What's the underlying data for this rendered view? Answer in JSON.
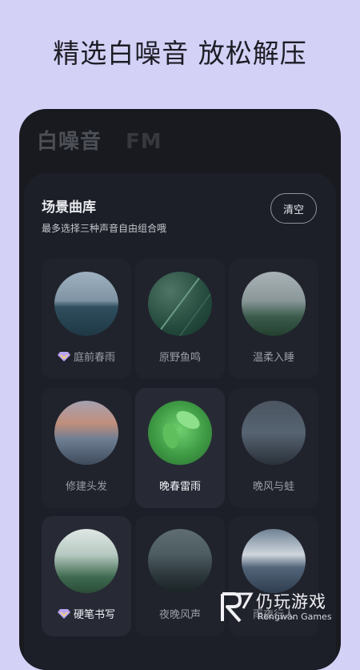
{
  "headline": "精选白噪音  放松解压",
  "tabs": [
    {
      "label": "白噪音",
      "active": true
    },
    {
      "label": "FM",
      "active": false
    }
  ],
  "library": {
    "title": "场景曲库",
    "subtitle": "最多选择三种声音自由组合哦",
    "clear_label": "清空"
  },
  "sounds": [
    {
      "label": "庭前春雨",
      "vip": true,
      "selected": false
    },
    {
      "label": "原野鱼鸣",
      "vip": false,
      "selected": false
    },
    {
      "label": "温柔入睡",
      "vip": false,
      "selected": false
    },
    {
      "label": "修建头发",
      "vip": false,
      "selected": false
    },
    {
      "label": "晚春雷雨",
      "vip": false,
      "selected": true
    },
    {
      "label": "晚风与蛙",
      "vip": false,
      "selected": false
    },
    {
      "label": "硬笔书写",
      "vip": true,
      "selected": true
    },
    {
      "label": "夜晚风声",
      "vip": false,
      "selected": false
    },
    {
      "label": "雨夜行人",
      "vip": false,
      "selected": false
    }
  ],
  "colors": {
    "page_bg": "#d3d1f6",
    "panel_bg": "#1c1f28",
    "vip_accent": "#b9a4f4"
  },
  "watermark": {
    "brand_cn": "仍玩游戏",
    "brand_en": "Rengwan Games"
  }
}
